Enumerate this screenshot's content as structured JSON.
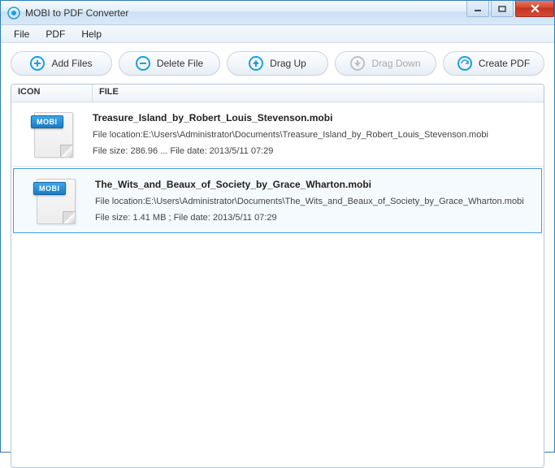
{
  "window": {
    "title": "MOBI to PDF Converter"
  },
  "menu": {
    "file": "File",
    "pdf": "PDF",
    "help": "Help"
  },
  "toolbar": {
    "add_files": "Add Files",
    "delete_file": "Delete File",
    "drag_up": "Drag Up",
    "drag_down": "Drag Down",
    "create_pdf": "Create PDF"
  },
  "columns": {
    "icon": "ICON",
    "file": "FILE"
  },
  "files": [
    {
      "badge": "MOBI",
      "name": "Treasure_Island_by_Robert_Louis_Stevenson.mobi",
      "location": "File location:E:\\Users\\Administrator\\Documents\\Treasure_Island_by_Robert_Louis_Stevenson.mobi",
      "stats": "File size: 286.96 ...  File date: 2013/5/11 07:29",
      "selected": false
    },
    {
      "badge": "MOBI",
      "name": "The_Wits_and_Beaux_of_Society_by_Grace_Wharton.mobi",
      "location": "File location:E:\\Users\\Administrator\\Documents\\The_Wits_and_Beaux_of_Society_by_Grace_Wharton.mobi",
      "stats": "File size: 1.41 MB ;   File date: 2013/5/11 07:29",
      "selected": true
    }
  ]
}
